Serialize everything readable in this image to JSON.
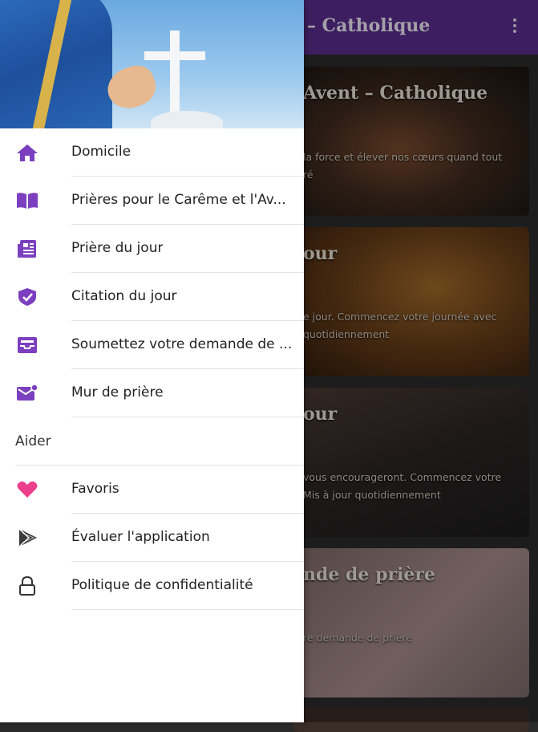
{
  "app": {
    "toolbar_title": "– Catholique",
    "cards": [
      {
        "title": "Avent – Catholique",
        "description": "la force et élever nos cœurs quand tout\nré"
      },
      {
        "title": "our",
        "description": "e jour. Commencez votre journée avec\nquotidiennement"
      },
      {
        "title": "our",
        "description": "vous encourageront. Commencez votre\nMis à jour quotidiennement"
      },
      {
        "title": "nde de prière",
        "description": "re demande de prière"
      }
    ]
  },
  "drawer": {
    "items": [
      {
        "label": "Domicile",
        "icon": "home-icon"
      },
      {
        "label": "Prières pour le Carême et l'Av...",
        "icon": "book-icon"
      },
      {
        "label": "Prière du jour",
        "icon": "news-icon"
      },
      {
        "label": "Citation du jour",
        "icon": "shield-check-icon"
      },
      {
        "label": "Soumettez votre demande de ...",
        "icon": "inbox-icon"
      },
      {
        "label": "Mur de prière",
        "icon": "mail-icon"
      }
    ],
    "section_label": "Aider",
    "help_items": [
      {
        "label": "Favoris",
        "icon": "heart-icon"
      },
      {
        "label": "Évaluer l'application",
        "icon": "play-store-icon"
      },
      {
        "label": "Politique de confidentialité",
        "icon": "lock-icon"
      }
    ]
  },
  "colors": {
    "accent": "#7b3fbf",
    "appbar": "#5b2d8e",
    "heart": "#ec3f8c"
  }
}
